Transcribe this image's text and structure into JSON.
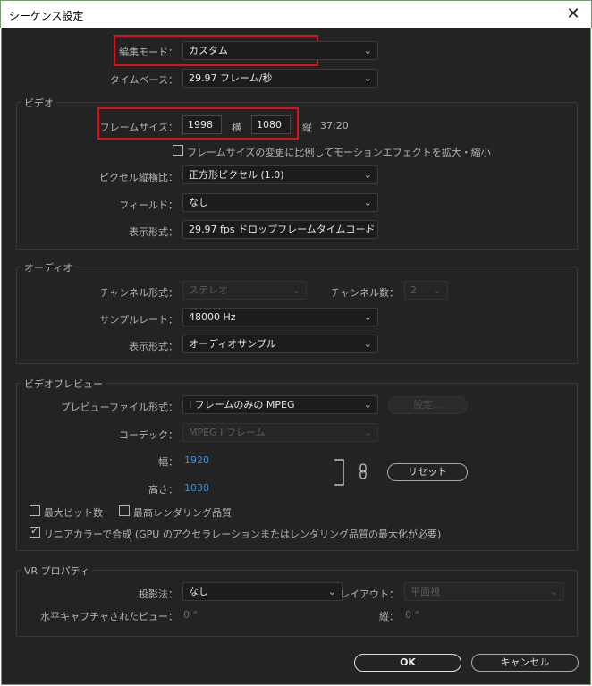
{
  "window": {
    "title": "シーケンス設定",
    "close": "✕"
  },
  "general": {
    "edit_mode_label": "編集モード：",
    "edit_mode_value": "カスタム",
    "timebase_label": "タイムベース：",
    "timebase_value": "29.97 フレーム/秒"
  },
  "video": {
    "group": "ビデオ",
    "frame_size_label": "フレームサイズ：",
    "frame_width": "1998",
    "width_unit": "横",
    "frame_height": "1080",
    "height_unit": "縦",
    "aspect": "37:20",
    "scale_checkbox": "フレームサイズの変更に比例してモーションエフェクトを拡大・縮小",
    "pixel_aspect_label": "ピクセル縦横比：",
    "pixel_aspect_value": "正方形ピクセル (1.0)",
    "fields_label": "フィールド：",
    "fields_value": "なし",
    "display_format_label": "表示形式：",
    "display_format_value": "29.97 fps ドロップフレームタイムコード"
  },
  "audio": {
    "group": "オーディオ",
    "channel_format_label": "チャンネル形式：",
    "channel_format_value": "ステレオ",
    "channel_count_label": "チャンネル数：",
    "channel_count_value": "2",
    "sample_rate_label": "サンプルレート：",
    "sample_rate_value": "48000 Hz",
    "display_format_label": "表示形式：",
    "display_format_value": "オーディオサンプル"
  },
  "preview": {
    "group": "ビデオプレビュー",
    "file_format_label": "プレビューファイル形式：",
    "file_format_value": "I フレームのみの MPEG",
    "settings_button": "設定...",
    "codec_label": "コーデック：",
    "codec_value": "MPEG I フレーム",
    "width_label": "幅：",
    "width_value": "1920",
    "height_label": "高さ：",
    "height_value": "1038",
    "reset_button": "リセット",
    "max_bit_depth": "最大ビット数",
    "max_render_quality": "最高レンダリング品質",
    "linear_color": "リニアカラーで合成 (GPU のアクセラレーションまたはレンダリング品質の最大化が必要)"
  },
  "vr": {
    "group": "VR プロパティ",
    "projection_label": "投影法：",
    "projection_value": "なし",
    "layout_label": "レイアウト：",
    "layout_value": "平面視",
    "h_view_label": "水平キャプチャされたビュー：",
    "h_view_value": "0 °",
    "v_label": "縦：",
    "v_value": "0 °"
  },
  "footer": {
    "ok": "OK",
    "cancel": "キャンセル"
  }
}
